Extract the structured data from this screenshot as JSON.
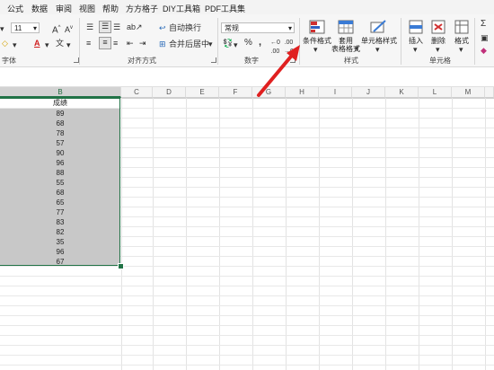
{
  "menu": [
    "公式",
    "数据",
    "审阅",
    "视图",
    "帮助",
    "方方格子",
    "DIY工具箱",
    "PDF工具集"
  ],
  "ribbon": {
    "font_group_label": "字体",
    "font_size": "11",
    "align_group_label": "对齐方式",
    "wrap_text": "自动换行",
    "merge_center": "合并后居中",
    "number_group_label": "数字",
    "number_format": "常规",
    "styles_group_label": "样式",
    "conditional_format": "条件格式",
    "table_format_line1": "套用",
    "table_format_line2": "表格格式",
    "cell_styles": "单元格样式",
    "cells_group_label": "单元格",
    "insert": "插入",
    "delete": "删除",
    "format": "格式"
  },
  "columns": [
    "B",
    "C",
    "D",
    "E",
    "F",
    "G",
    "H",
    "I",
    "J",
    "K",
    "L",
    "M"
  ],
  "header_cell": "成绩",
  "scores": [
    "89",
    "68",
    "78",
    "57",
    "90",
    "96",
    "88",
    "55",
    "68",
    "65",
    "77",
    "83",
    "82",
    "35",
    "96",
    "67"
  ],
  "colors": {
    "selection": "#c8c8c8",
    "selection_border": "#217346",
    "arrow": "#e02020",
    "accent": "#217346"
  }
}
